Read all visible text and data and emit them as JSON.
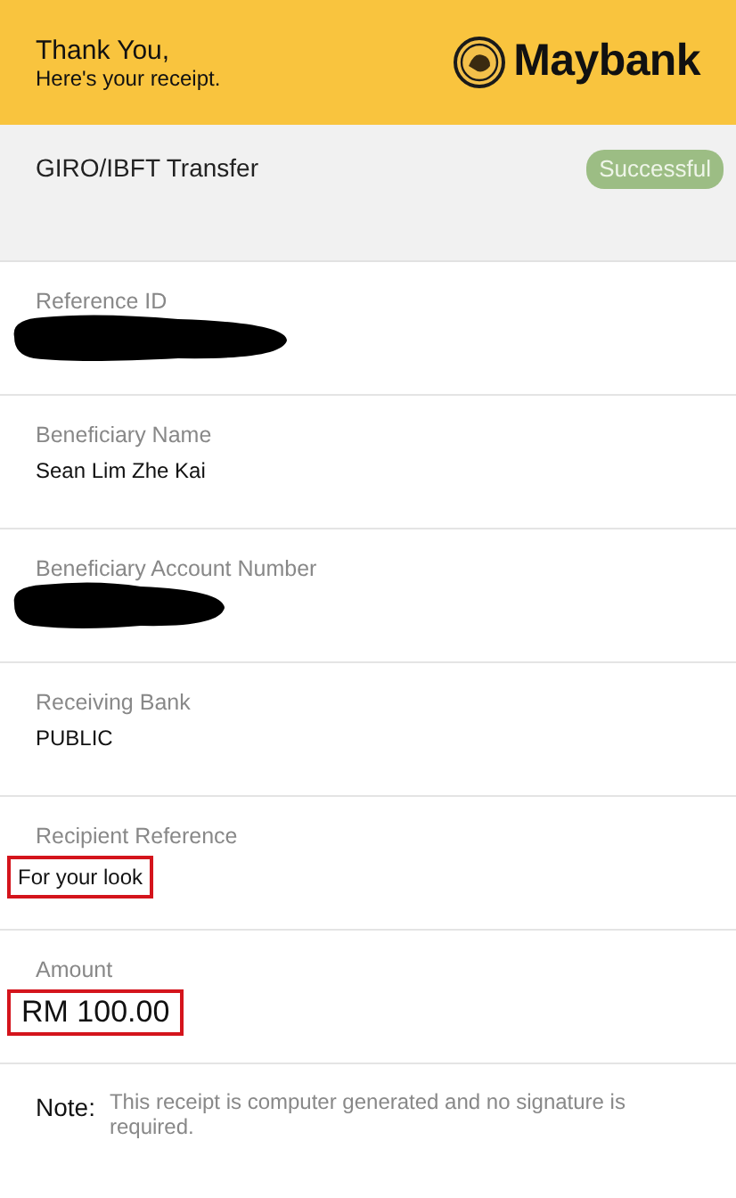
{
  "header": {
    "title": "Thank You,",
    "subtitle": "Here's your receipt.",
    "brand": "Maybank"
  },
  "transaction": {
    "type": "GIRO/IBFT Transfer",
    "status": "Successful"
  },
  "fields": [
    {
      "label": "Reference ID",
      "kind": "redacted",
      "highlighted": false
    },
    {
      "label": "Beneficiary Name",
      "kind": "text",
      "value": "Sean Lim Zhe Kai",
      "highlighted": false
    },
    {
      "label": "Beneficiary Account Number",
      "kind": "redacted",
      "highlighted": false
    },
    {
      "label": "Receiving Bank",
      "kind": "text",
      "value": "PUBLIC",
      "highlighted": false
    },
    {
      "label": "Recipient Reference",
      "kind": "text",
      "value": "For your look",
      "highlighted": true
    },
    {
      "label": "Amount",
      "kind": "amount",
      "value": "RM 100.00",
      "highlighted": true
    }
  ],
  "note": {
    "label": "Note:",
    "text": "This receipt is computer generated and no signature is required."
  }
}
